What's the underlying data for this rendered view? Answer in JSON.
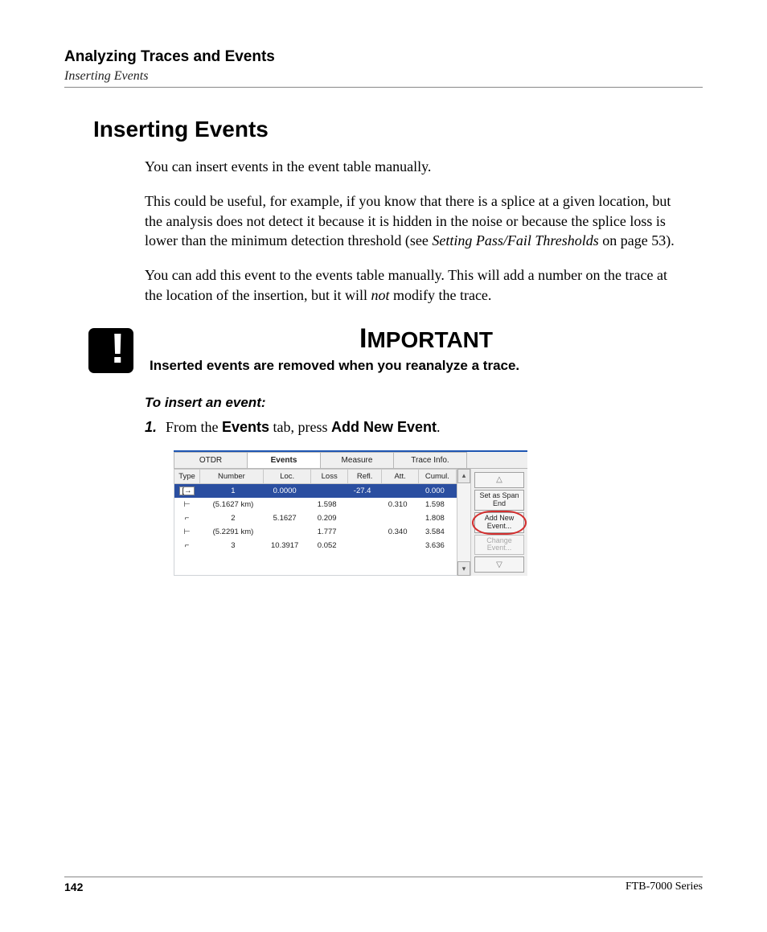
{
  "header": {
    "chapter": "Analyzing Traces and Events",
    "section_sub": "Inserting Events"
  },
  "heading": "Inserting Events",
  "paras": {
    "p1": "You can insert events in the event table manually.",
    "p2a": "This could be useful, for example, if you know that there is a splice at a given location, but the analysis does not detect it because it is hidden in the noise or because the splice loss is lower than the minimum detection threshold (see ",
    "p2_ref": "Setting Pass/Fail Thresholds",
    "p2b": " on page 53).",
    "p3a": "You can add this event to the events table manually. This will add a number on the trace at the location of the insertion, but it will ",
    "p3_not": "not",
    "p3b": " modify the trace."
  },
  "important": {
    "title_big": "I",
    "title_rest": "MPORTANT",
    "body": "Inserted events are removed when you reanalyze a trace."
  },
  "procedure": {
    "title": "To insert an event:",
    "step1_num": "1.",
    "step1_a": "From the ",
    "step1_b": "Events",
    "step1_c": " tab, press ",
    "step1_d": "Add New Event",
    "step1_e": "."
  },
  "ui": {
    "tabs": [
      "OTDR",
      "Events",
      "Measure",
      "Trace Info."
    ],
    "active_tab_index": 1,
    "columns": [
      "Type",
      "Number",
      "Loc.",
      "Loss",
      "Refl.",
      "Att.",
      "Cumul."
    ],
    "rows": [
      {
        "type_glyph": "[→",
        "number": "1",
        "loc": "0.0000",
        "loss": "",
        "refl": "-27.4",
        "att": "",
        "cumul": "0.000",
        "selected": true
      },
      {
        "type_glyph": "⊢",
        "number": "(5.1627 km)",
        "loc": "",
        "loss": "1.598",
        "refl": "",
        "att": "0.310",
        "cumul": "1.598",
        "selected": false
      },
      {
        "type_glyph": "⌐",
        "number": "2",
        "loc": "5.1627",
        "loss": "0.209",
        "refl": "",
        "att": "",
        "cumul": "1.808",
        "selected": false
      },
      {
        "type_glyph": "⊢",
        "number": "(5.2291 km)",
        "loc": "",
        "loss": "1.777",
        "refl": "",
        "att": "0.340",
        "cumul": "3.584",
        "selected": false
      },
      {
        "type_glyph": "⌐",
        "number": "3",
        "loc": "10.3917",
        "loss": "0.052",
        "refl": "",
        "att": "",
        "cumul": "3.636",
        "selected": false
      }
    ],
    "side_buttons": {
      "set_span_end": "Set as Span End",
      "add_new_event": "Add New Event...",
      "change_event": "Change Event..."
    }
  },
  "footer": {
    "page_number": "142",
    "product": "FTB-7000 Series"
  }
}
